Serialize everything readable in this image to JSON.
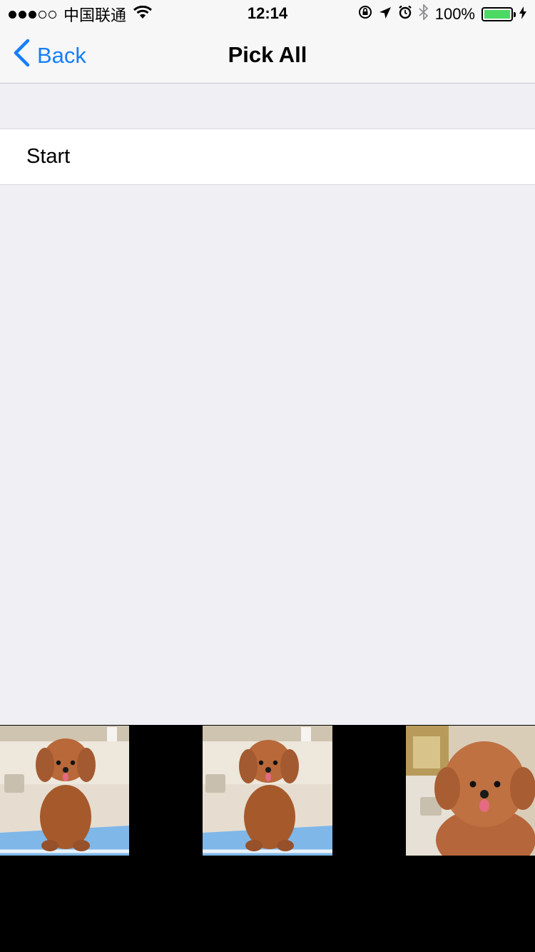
{
  "status_bar": {
    "carrier": "中国联通",
    "time": "12:14",
    "battery": "100%",
    "signal_strength": 3,
    "signal_max": 5,
    "icons": [
      "wifi-icon",
      "orientation-lock-icon",
      "location-arrow-icon",
      "alarm-icon",
      "bluetooth-icon",
      "battery-icon",
      "charging-bolt-icon"
    ]
  },
  "nav": {
    "back_label": "Back",
    "title": "Pick All"
  },
  "table": {
    "rows": [
      {
        "label": "Start"
      }
    ]
  },
  "photos": {
    "count": 3,
    "subject": "poodle-photo"
  },
  "colors": {
    "accent": "#157efb",
    "background": "#efeff4",
    "battery_fill": "#4cd964"
  }
}
